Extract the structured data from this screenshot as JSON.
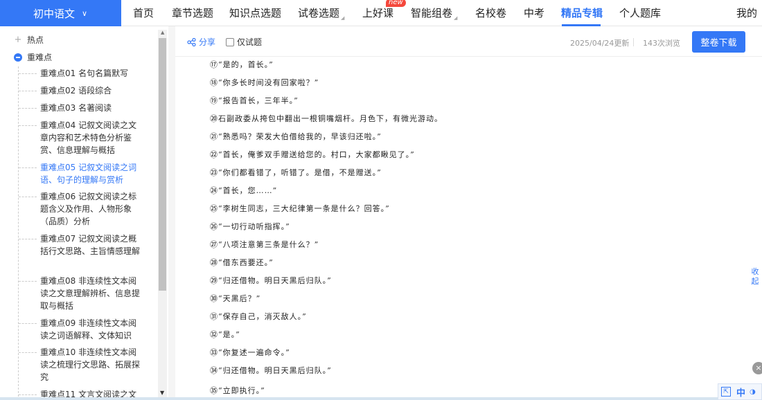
{
  "nav": {
    "subject": "初中语文",
    "items": [
      {
        "label": "首页"
      },
      {
        "label": "章节选题"
      },
      {
        "label": "知识点选题"
      },
      {
        "label": "试卷选题"
      },
      {
        "label": "上好课"
      },
      {
        "label": "智能组卷"
      },
      {
        "label": "名校卷"
      },
      {
        "label": "中考"
      },
      {
        "label": "精品专辑"
      },
      {
        "label": "个人题库"
      },
      {
        "label": "我的"
      }
    ],
    "new_badge": "new",
    "active": "精品专辑"
  },
  "sidebar": {
    "hot": "热点",
    "key": "重难点",
    "items": [
      {
        "label": "重难点01 名句名篇默写"
      },
      {
        "label": "重难点02 语段综合"
      },
      {
        "label": "重难点03 名著阅读"
      },
      {
        "label": "重难点04 记叙文阅读之文章内容和艺术特色分析鉴赏、信息理解与概括"
      },
      {
        "label": "重难点05 记叙文阅读之词语、句子的理解与赏析"
      },
      {
        "label": "重难点06 记叙文阅读之标题含义及作用、人物形象（品质）分析"
      },
      {
        "label": "重难点07 记叙文阅读之概括行文思路、主旨情感理解"
      },
      {
        "label": "重难点08 非连续性文本阅读之文意理解辨析、信息提取与概括"
      },
      {
        "label": "重难点09 非连续性文本阅读之词语解释、文体知识"
      },
      {
        "label": "重难点10 非连续性文本阅读之梳理行文思路、拓展探究"
      },
      {
        "label": "重难点11 文言文阅读之文"
      }
    ],
    "selected_index": 4
  },
  "toolbar": {
    "share": "分享",
    "trial_only": "仅试题",
    "trial_checked": false,
    "updated": "2025/04/24更新",
    "views": "143次浏览",
    "download": "整卷下载"
  },
  "content": {
    "lines": [
      "⑰“是的，首长。”",
      "⑱“你多长时间没有回家啦？”",
      "⑲“报告首长，三年半。”",
      "⑳石副政委从挎包中翻出一根铜嘴烟杆。月色下，有微光游动。",
      "㉑“熟悉吗？荣发大伯借给我的，早该归还啦。”",
      "㉒“首长，俺爹双手赠送给您的。村口，大家都瞅见了。”",
      "㉓“你们都看错了，听错了。是借，不是赠送。”",
      "㉔“首长，您……”",
      "㉕“李树生同志，三大纪律第一条是什么？回答。”",
      "㉖“一切行动听指挥。”",
      "㉗“八项注意第三条是什么？”",
      "㉘“借东西要还。”",
      "㉙“归还借物。明日天黑后归队。”",
      "㉚“天黑后？”",
      "㉛“保存自己，消灭敌人。”",
      "㉜“是。”",
      "㉝“你复述一遍命令。”",
      "㉞“归还借物。明日天黑后归队。”",
      "㉟“立即执行。”"
    ]
  },
  "widgets": {
    "collapse": "收起",
    "close": "×",
    "ime_zh": "中",
    "ime_punct": "◑"
  }
}
